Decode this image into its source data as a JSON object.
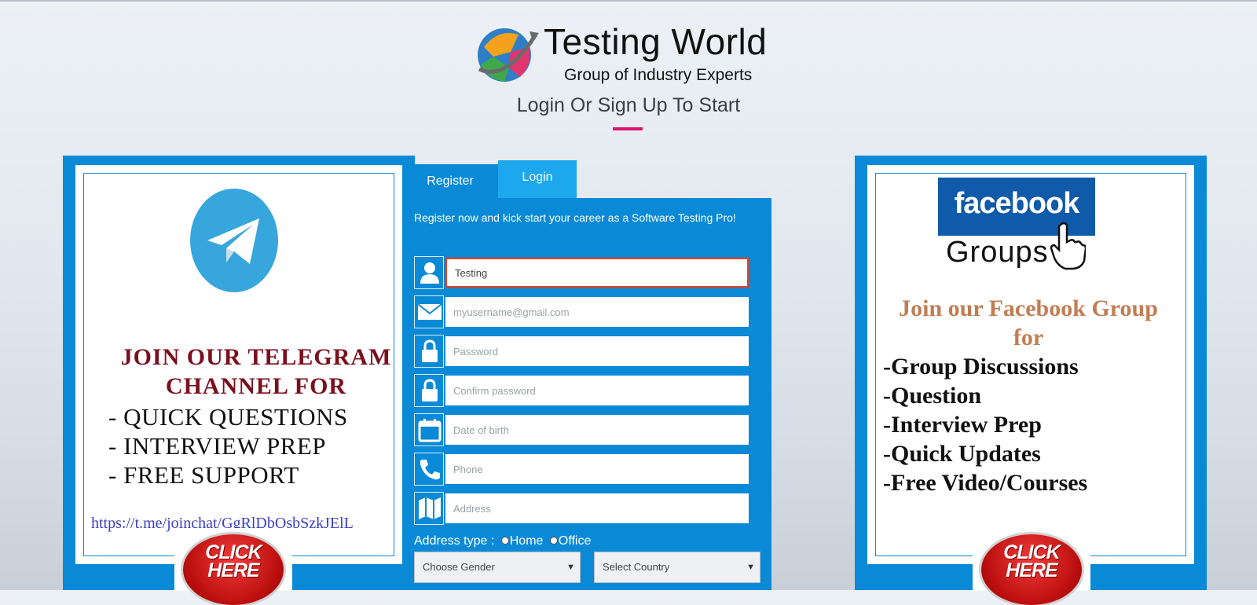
{
  "header": {
    "logo_title": "Testing World",
    "logo_tagline": "Group of Industry Experts",
    "subheading": "Login Or Sign Up To Start"
  },
  "left_promo": {
    "heading_line1": "JOIN OUR TELEGRAM",
    "heading_line2": "CHANNEL  FOR",
    "items": [
      "- QUICK QUESTIONS",
      "- INTERVIEW PREP",
      "- FREE SUPPORT"
    ],
    "link": "https://t.me/joinchat/GgRlDbOsbSzkJElL",
    "click_line1": "CLICK",
    "click_line2": "HERE"
  },
  "right_promo": {
    "fb_logo_text": "facebook",
    "fb_groups_text": "Groups",
    "heading_line1": "Join our Facebook Group",
    "heading_line2": "for",
    "items": [
      "-Group Discussions",
      "-Question",
      "-Interview Prep",
      "-Quick Updates",
      "-Free Video/Courses"
    ],
    "click_line1": "CLICK",
    "click_line2": "HERE"
  },
  "tabs": {
    "register": "Register",
    "login": "Login"
  },
  "form": {
    "intro": "Register now and kick start your career as a Software Testing Pro!",
    "fields": [
      {
        "icon": "user-icon",
        "value": "Testing",
        "placeholder": ""
      },
      {
        "icon": "envelope-icon",
        "value": "",
        "placeholder": "myusername@gmail.com"
      },
      {
        "icon": "lock-icon",
        "value": "",
        "placeholder": "Password"
      },
      {
        "icon": "lock-icon",
        "value": "",
        "placeholder": "Confirm password"
      },
      {
        "icon": "calendar-icon",
        "value": "",
        "placeholder": "Date of birth"
      },
      {
        "icon": "phone-icon",
        "value": "",
        "placeholder": "Phone"
      },
      {
        "icon": "map-icon",
        "value": "",
        "placeholder": "Address"
      }
    ],
    "address_type_label": "Address type :",
    "address_home": "Home",
    "address_office": "Office",
    "gender_select": "Choose Gender",
    "country_select": "Select Country"
  },
  "colors": {
    "panel_blue": "#0a8ad6",
    "tab_light_blue": "#1da8ed",
    "accent_pink": "#e0126f",
    "telegram_red": "#7c0f1f",
    "facebook_orange": "#c27d53"
  }
}
